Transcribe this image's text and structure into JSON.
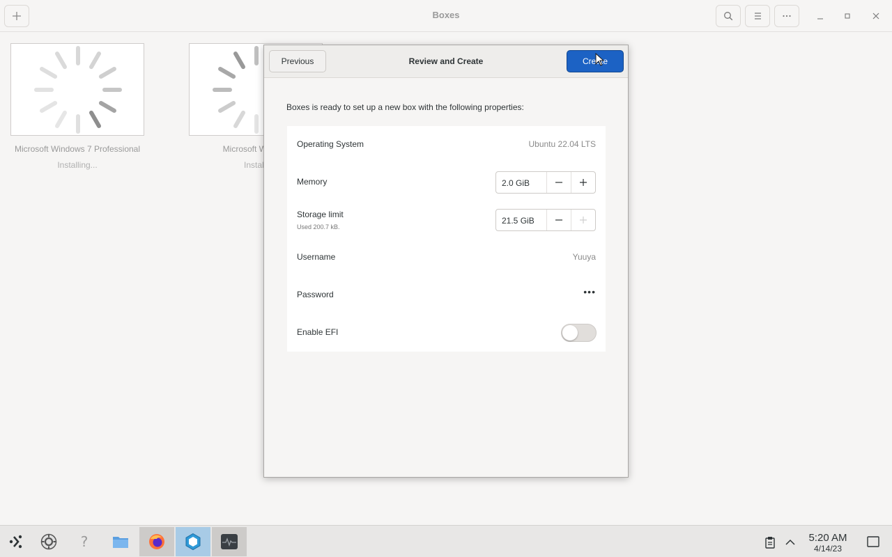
{
  "window": {
    "title": "Boxes"
  },
  "boxes": [
    {
      "name": "Microsoft Windows 7 Professional",
      "status": "Installing..."
    },
    {
      "name": "Microsoft Window",
      "status": "Installi"
    }
  ],
  "dialog": {
    "title": "Review and Create",
    "previous_label": "Previous",
    "create_label": "Create",
    "intro": "Boxes is ready to set up a new box with the following properties:",
    "properties": {
      "os": {
        "label": "Operating System",
        "value": "Ubuntu 22.04 LTS"
      },
      "memory": {
        "label": "Memory",
        "value": "2.0 GiB"
      },
      "storage": {
        "label": "Storage limit",
        "sublabel": "Used 200.7 kB.",
        "value": "21.5 GiB"
      },
      "username": {
        "label": "Username",
        "value": "Yuuya"
      },
      "password": {
        "label": "Password",
        "value": "•••"
      },
      "efi": {
        "label": "Enable EFI",
        "enabled": false
      }
    }
  },
  "taskbar": {
    "time": "5:20 AM",
    "date": "4/14/23",
    "apps": [
      "launcher-icon",
      "settings-icon",
      "help-icon",
      "files-icon",
      "firefox-icon",
      "boxes-icon",
      "system-monitor-icon"
    ]
  },
  "colors": {
    "accent": "#1c62c4",
    "background": "#f6f5f4"
  }
}
